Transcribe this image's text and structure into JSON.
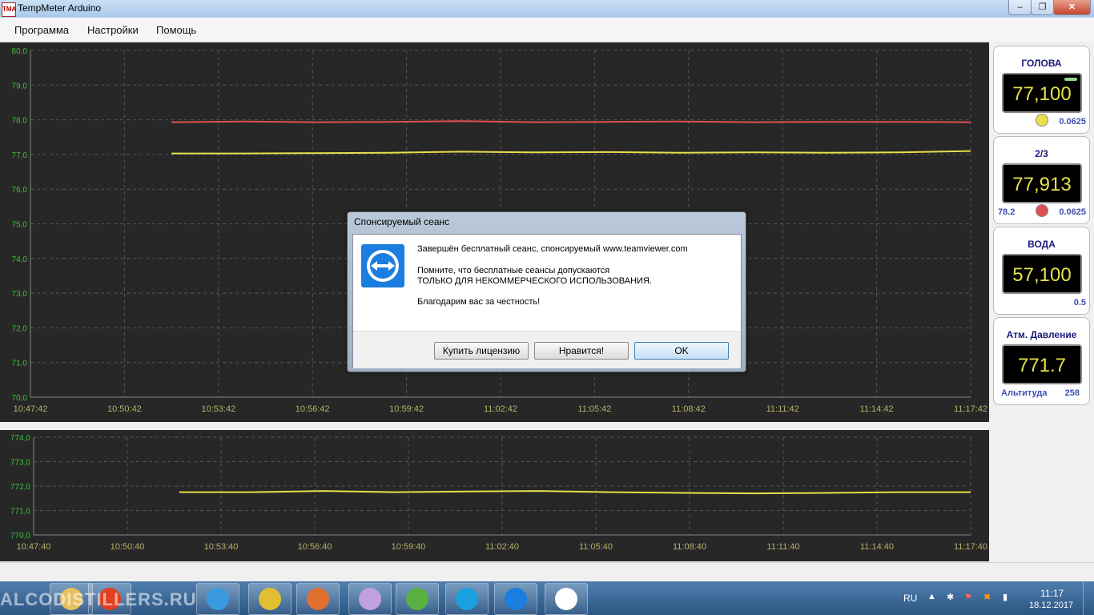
{
  "window": {
    "title": "TempMeter Arduino",
    "icon_text": "TMA"
  },
  "menu": [
    "Программа",
    "Настройки",
    "Помощь"
  ],
  "sensors": [
    {
      "title": "ГОЛОВА",
      "value": "77,100",
      "left": "",
      "right": "0.0625",
      "dot_color": "#e6e04a"
    },
    {
      "title": "2/3",
      "value": "77,913",
      "left": "78.2",
      "right": "0.0625",
      "dot_color": "#e05050"
    },
    {
      "title": "ВОДА",
      "value": "57,100",
      "left": "",
      "right": "0.5",
      "dot_color": ""
    },
    {
      "title": "Атм. Давление",
      "value": "771.7",
      "left": "Альтитуда",
      "right": "258",
      "dot_color": ""
    }
  ],
  "chart_data": [
    {
      "type": "line",
      "ylim": [
        70.0,
        80.0
      ],
      "yticks": [
        "80,0",
        "79,0",
        "78,0",
        "77,0",
        "76,0",
        "75,0",
        "74,0",
        "73,0",
        "72,0",
        "71,0",
        "70,0"
      ],
      "xticks": [
        "10:47:42",
        "10:50:42",
        "10:53:42",
        "10:56:42",
        "10:59:42",
        "11:02:42",
        "11:05:42",
        "11:08:42",
        "11:11:42",
        "11:14:42",
        "11:17:42"
      ],
      "x_range": [
        "10:47:42",
        "11:17:42"
      ],
      "series": [
        {
          "color": "#e05050",
          "x_start": "10:52:12",
          "x_end": "11:17:42",
          "values": [
            77.93,
            77.95,
            77.93,
            77.94,
            77.96,
            77.93,
            77.94,
            77.95,
            77.93,
            77.94,
            77.94,
            77.93
          ]
        },
        {
          "color": "#e6e04a",
          "x_start": "10:52:12",
          "x_end": "11:17:42",
          "values": [
            77.03,
            77.03,
            77.04,
            77.05,
            77.08,
            77.06,
            77.07,
            77.05,
            77.06,
            77.05,
            77.06,
            77.1
          ]
        }
      ]
    },
    {
      "type": "line",
      "ylim": [
        770.0,
        774.0
      ],
      "yticks": [
        "774,0",
        "773,0",
        "772,0",
        "771,0",
        "770,0"
      ],
      "xticks": [
        "10:47:40",
        "10:50:40",
        "10:53:40",
        "10:56:40",
        "10:59:40",
        "11:02:40",
        "11:05:40",
        "11:08:40",
        "11:11:40",
        "11:14:40",
        "11:17:40"
      ],
      "x_range": [
        "10:47:40",
        "11:17:40"
      ],
      "series": [
        {
          "color": "#e6e04a",
          "x_start": "10:52:20",
          "x_end": "11:17:40",
          "values": [
            771.75,
            771.75,
            771.8,
            771.75,
            771.78,
            771.8,
            771.75,
            771.72,
            771.7,
            771.72,
            771.75,
            771.75
          ]
        }
      ]
    }
  ],
  "dialog": {
    "title": "Спонсируемый сеанс",
    "line1": "Завершён бесплатный сеанс, спонсируемый www.teamviewer.com",
    "line2": "Помните, что бесплатные сеансы допускаются",
    "line3": "ТОЛЬКО ДЛЯ НЕКОММЕРЧЕСКОГО ИСПОЛЬЗОВАНИЯ.",
    "line4": "Благодарим вас за честность!",
    "buttons": [
      "Купить лицензию",
      "Нравится!",
      "OK"
    ]
  },
  "taskbar": {
    "watermark": "ALCODISTILLERS.RU",
    "apps": [
      "explorer-icon",
      "yandex-icon",
      "ie-icon",
      "chrome-icon",
      "media-icon",
      "paint-icon",
      "utorrent-icon",
      "skype-icon",
      "teamviewer-icon",
      "tempmeter-icon"
    ],
    "lang": "RU",
    "time": "11:17",
    "date": "18.12.2017"
  }
}
